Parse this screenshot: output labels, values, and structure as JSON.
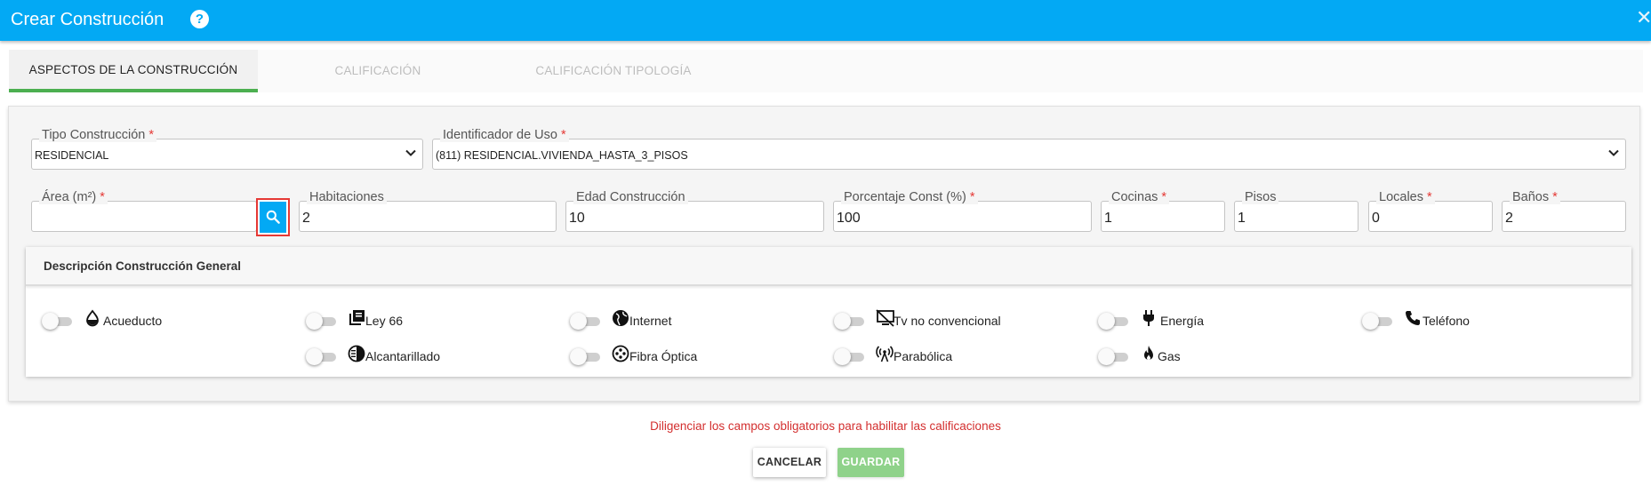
{
  "dialog": {
    "title": "Crear Construcción"
  },
  "tabs": [
    {
      "label": "ASPECTOS DE LA CONSTRUCCIÓN",
      "state": "active"
    },
    {
      "label": "CALIFICACIÓN",
      "state": "disabled"
    },
    {
      "label": "CALIFICACIÓN TIPOLOGÍA",
      "state": "disabled"
    }
  ],
  "fields": {
    "tipo_construccion": {
      "label": "Tipo Construcción",
      "required_mark": "*",
      "value": "RESIDENCIAL"
    },
    "identificador_uso": {
      "label": "Identificador de Uso",
      "required_mark": "*",
      "value": "(811) RESIDENCIAL.VIVIENDA_HASTA_3_PISOS"
    },
    "area": {
      "label": "Área (m²)",
      "required_mark": "*",
      "value": ""
    },
    "habitaciones": {
      "label": "Habitaciones",
      "value": "2"
    },
    "edad_construccion": {
      "label": "Edad Construcción",
      "value": "10"
    },
    "porcentaje_const": {
      "label": "Porcentaje Const (%)",
      "required_mark": "*",
      "value": "100"
    },
    "cocinas": {
      "label": "Cocinas",
      "required_mark": "*",
      "value": "1"
    },
    "pisos": {
      "label": "Pisos",
      "value": "1"
    },
    "locales": {
      "label": "Locales",
      "required_mark": "*",
      "value": "0"
    },
    "banos": {
      "label": "Baños",
      "required_mark": "*",
      "value": "2"
    }
  },
  "description": {
    "title": "Descripción Construcción General",
    "services": [
      {
        "label": "Acueducto",
        "icon": "water-drop-icon",
        "on": false
      },
      {
        "label": "Ley 66",
        "icon": "library-books-icon",
        "on": false
      },
      {
        "label": "Internet",
        "icon": "globe-icon",
        "on": false
      },
      {
        "label": "Tv no convencional",
        "icon": "tv-off-icon",
        "on": false
      },
      {
        "label": "Energía",
        "icon": "power-plug-icon",
        "on": false
      },
      {
        "label": "Teléfono",
        "icon": "phone-icon",
        "on": false
      },
      {
        "label": "Alcantarillado",
        "icon": "half-circle-icon",
        "on": false
      },
      {
        "label": "Fibra Óptica",
        "icon": "fiber-optic-icon",
        "on": false
      },
      {
        "label": "Parabólica",
        "icon": "antenna-icon",
        "on": false
      },
      {
        "label": "Gas",
        "icon": "flame-icon",
        "on": false
      }
    ]
  },
  "footer": {
    "warning": "Diligenciar los campos obligatorios para habilitar las calificaciones",
    "cancel_label": "CANCELAR",
    "save_label": "GUARDAR"
  },
  "colors": {
    "header": "#03a9f4",
    "active_tab_indicator": "#4caf50",
    "required": "#e53935",
    "save_button_disabled": "#8fd28a",
    "warning_text": "#d32f2f"
  }
}
